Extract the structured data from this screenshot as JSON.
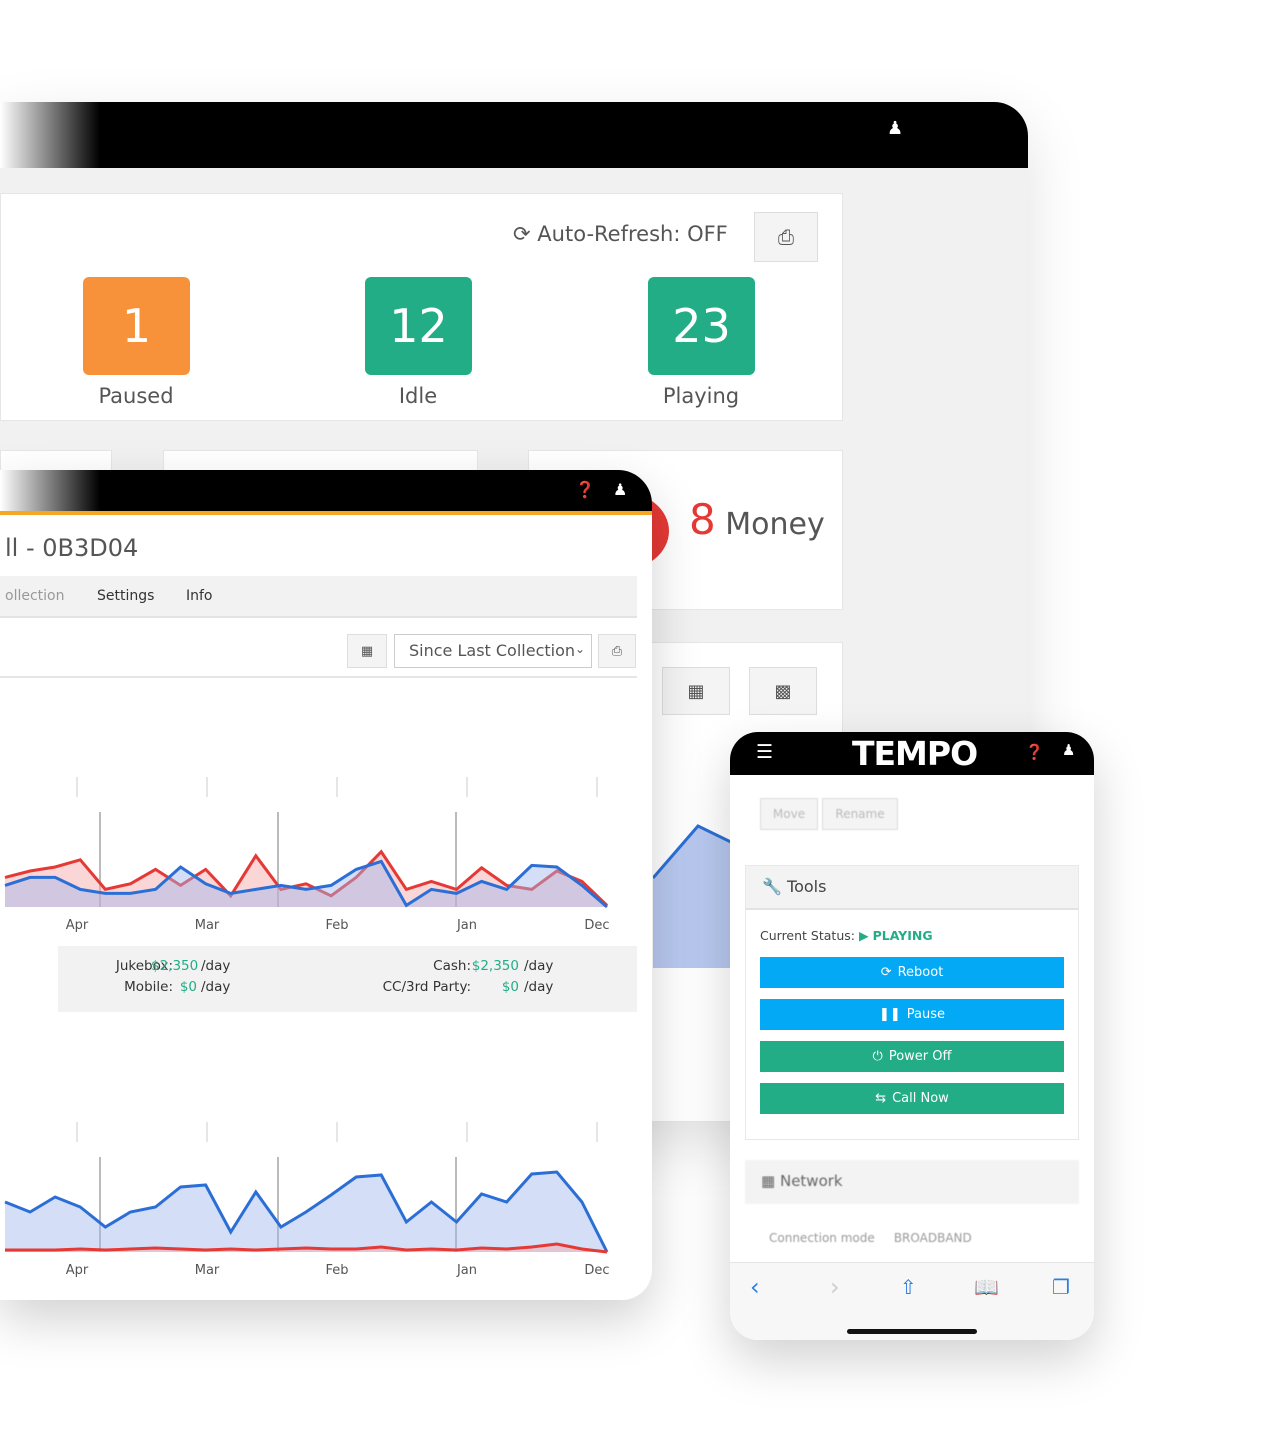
{
  "desktop": {
    "auto_refresh": "Auto-Refresh: OFF",
    "stats": [
      {
        "value": "1",
        "label": "Paused",
        "color": "#f7923a"
      },
      {
        "value": "12",
        "label": "Idle",
        "color": "#23ad87"
      },
      {
        "value": "23",
        "label": "Playing",
        "color": "#23ad87"
      }
    ],
    "money_count": "8",
    "money_label": "Money",
    "accent_red": "#e53935"
  },
  "tablet": {
    "title": "ll - 0B3D04",
    "tabs": [
      "ollection",
      "Settings",
      "Info"
    ],
    "range_select": "Since Last Collection",
    "x_labels": [
      "Apr",
      "Mar",
      "Feb",
      "Jan",
      "Dec"
    ],
    "summary": {
      "jukebox_label": "Jukebox:",
      "jukebox_value": "$2,350",
      "mobile_label": "Mobile:",
      "mobile_value": "$0",
      "cash_label": "Cash:",
      "cash_value": "$2,350",
      "cc_label": "CC/3rd Party:",
      "cc_value": "$0",
      "per_day": "/day"
    }
  },
  "chart_data": [
    {
      "type": "area",
      "categories": [
        "Apr",
        "Mar",
        "Feb",
        "Jan",
        "Dec"
      ],
      "series": [
        {
          "color": "#e53935",
          "values": [
            37,
            45,
            50,
            59,
            22,
            29,
            47,
            27,
            47,
            14,
            64,
            22,
            29,
            14,
            37,
            69,
            22,
            32,
            22,
            49,
            27,
            22,
            45,
            32,
            2
          ]
        },
        {
          "color": "#2b6fd6",
          "values": [
            27,
            37,
            37,
            22,
            17,
            17,
            22,
            50,
            29,
            17,
            22,
            27,
            22,
            27,
            47,
            57,
            2,
            22,
            17,
            32,
            22,
            52,
            50,
            27,
            0
          ]
        }
      ]
    },
    {
      "type": "area",
      "categories": [
        "Apr",
        "Mar",
        "Feb",
        "Jan",
        "Dec"
      ],
      "series": [
        {
          "color": "#2b6fd6",
          "values": [
            50,
            40,
            55,
            45,
            25,
            40,
            45,
            65,
            67,
            20,
            60,
            25,
            40,
            57,
            75,
            77,
            30,
            50,
            30,
            58,
            50,
            78,
            80,
            50,
            0
          ]
        },
        {
          "color": "#e53935",
          "values": [
            2,
            2,
            2,
            3,
            2,
            3,
            4,
            3,
            2,
            3,
            2,
            3,
            4,
            3,
            3,
            5,
            2,
            3,
            2,
            4,
            3,
            5,
            8,
            3,
            0
          ]
        }
      ]
    }
  ],
  "phone": {
    "logo": "TEMPO",
    "move": "Move",
    "rename": "Rename",
    "tools_title": "Tools",
    "status_label": "Current Status:",
    "status_value": "PLAYING",
    "buttons": [
      {
        "label": "Reboot",
        "color": "#03a9f4"
      },
      {
        "label": "Pause",
        "color": "#03a9f4"
      },
      {
        "label": "Power Off",
        "color": "#23ad87"
      },
      {
        "label": "Call Now",
        "color": "#23ad87"
      }
    ],
    "network_title": "Network",
    "conn_label": "Connection mode",
    "conn_value": "BROADBAND"
  }
}
